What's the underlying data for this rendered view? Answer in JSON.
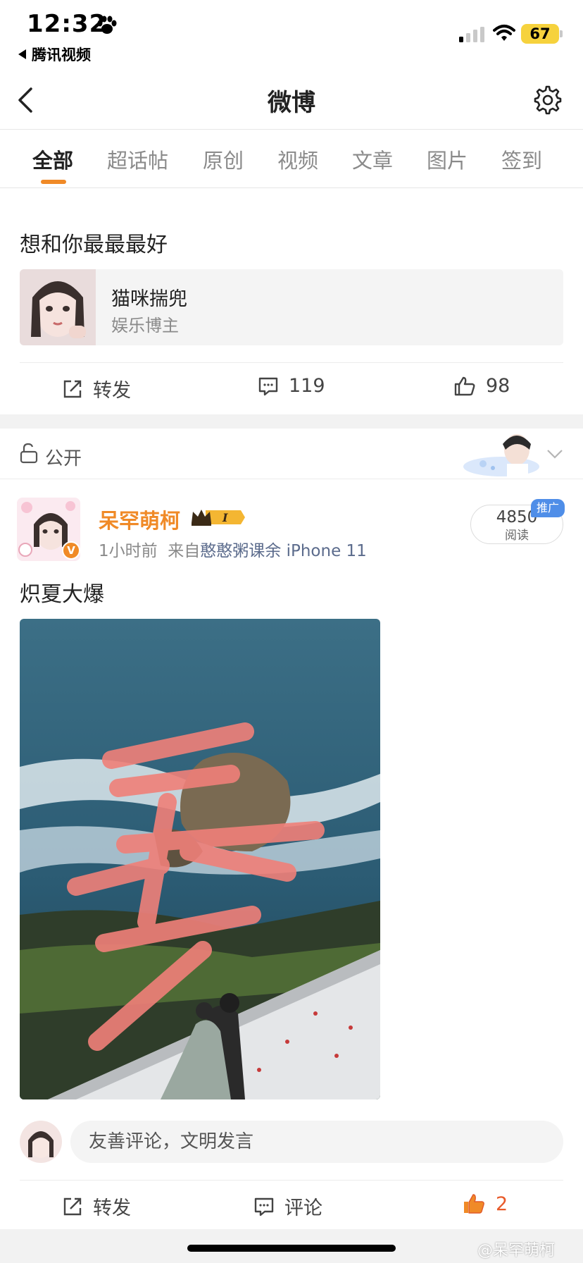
{
  "status_bar": {
    "time": "12:32",
    "back_app": "腾讯视频",
    "battery": "67"
  },
  "nav": {
    "title": "微博"
  },
  "tabs": [
    "全部",
    "超话帖",
    "原创",
    "视频",
    "文章",
    "图片",
    "签到"
  ],
  "first_card": {
    "title": "想和你最最最好",
    "share_name": "猫咪揣兜",
    "share_sub": "娱乐博主",
    "repost_label": "转发",
    "comments": "119",
    "likes": "98"
  },
  "visibility": {
    "label": "公开"
  },
  "post": {
    "author": "呆罕萌柯",
    "level_badge": "I",
    "time": "1小时前",
    "from_prefix": "来自",
    "source": "憨憨粥课余 iPhone 11",
    "reads": "4850",
    "reads_label": "阅读",
    "ad_tag": "推广",
    "text": "炽夏大爆",
    "comment_placeholder": "友善评论，文明发言",
    "repost_label": "转发",
    "comment_label": "评论",
    "likes": "2"
  },
  "watermark": "@呆罕萌柯",
  "colors": {
    "accent": "#f08a27",
    "ad_blue": "#4f8ee8",
    "link": "#5b6b8c"
  },
  "icons": [
    "paw-icon",
    "signal-icon",
    "wifi-icon",
    "back-icon",
    "gear-icon",
    "repost-icon",
    "comment-icon",
    "like-icon",
    "lock-icon",
    "chevron-down-icon",
    "crown-icon",
    "verified-icon"
  ]
}
